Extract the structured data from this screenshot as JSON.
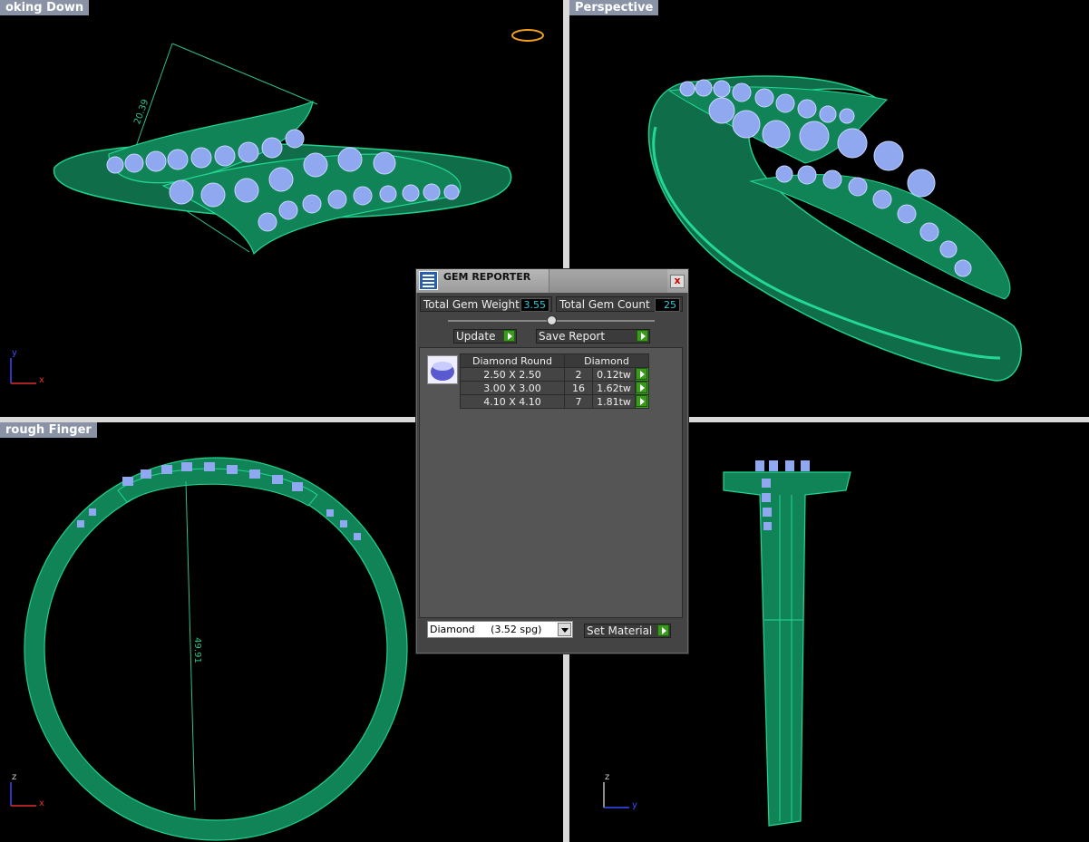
{
  "viewports": {
    "top_left": {
      "label": "oking Down",
      "dimension": "20.39",
      "axis_v": "y",
      "axis_h": "x"
    },
    "top_right": {
      "label": "Perspective"
    },
    "bottom_left": {
      "label": "rough Finger",
      "dimension": "49.91",
      "axis_v": "z",
      "axis_h": "x"
    },
    "bottom_right": {
      "label": "",
      "axis_v": "z",
      "axis_h": "y"
    }
  },
  "gem_reporter": {
    "title": "GEM REPORTER",
    "close": "x",
    "total_weight_label": "Total Gem Weight",
    "total_weight_value": "3.55",
    "total_count_label": "Total Gem Count",
    "total_count_value": "25",
    "update_label": "Update",
    "save_report_label": "Save Report",
    "table": {
      "headers": [
        "Diamond Round",
        "Diamond"
      ],
      "rows": [
        {
          "size": "2.50 X 2.50",
          "count": "2",
          "weight": "0.12tw"
        },
        {
          "size": "3.00 X 3.00",
          "count": "16",
          "weight": "1.62tw"
        },
        {
          "size": "4.10 X 4.10",
          "count": "7",
          "weight": "1.81tw"
        }
      ]
    },
    "material_select": "Diamond     (3.52 spg)",
    "set_material_label": "Set Material"
  },
  "colors": {
    "metal": "#1b9a6c",
    "gem": "#8fa8f0",
    "label_bg": "#8a93a6",
    "dimension_line": "#2fbf8a"
  },
  "icons": [
    "gumball-icon",
    "gem-reporter-icon",
    "close-icon",
    "arrow-right-icon",
    "dropdown-icon",
    "gem-thumbnail-icon"
  ]
}
